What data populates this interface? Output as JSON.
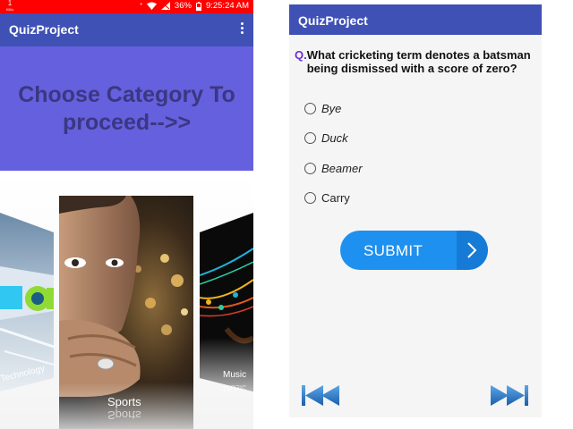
{
  "left": {
    "status": {
      "speed_value": "1",
      "speed_unit": "KB/s",
      "battery": "36%",
      "time": "9:25:24 AM"
    },
    "app_title": "QuizProject",
    "banner": {
      "line1": "Choose Category To",
      "line2": "proceed-->>"
    },
    "categories": [
      {
        "label": "Technology"
      },
      {
        "label": "Sports"
      },
      {
        "label": "Music"
      }
    ]
  },
  "right": {
    "app_title": "QuizProject",
    "question": {
      "prefix": "Q.",
      "text": "What cricketing term denotes a batsman being dismissed with a score of zero?"
    },
    "options": [
      {
        "label": "Bye",
        "italic": true
      },
      {
        "label": "Duck",
        "italic": true
      },
      {
        "label": "Beamer",
        "italic": true
      },
      {
        "label": "Carry",
        "italic": false
      }
    ],
    "submit_label": "SUBMIT"
  },
  "colors": {
    "status_bar": "#ff0000",
    "app_bar": "#3f51b5",
    "banner": "#6560dd",
    "banner_text": "#3b3782",
    "submit": "#1e90ef",
    "question_prefix": "#6b2fd6"
  }
}
